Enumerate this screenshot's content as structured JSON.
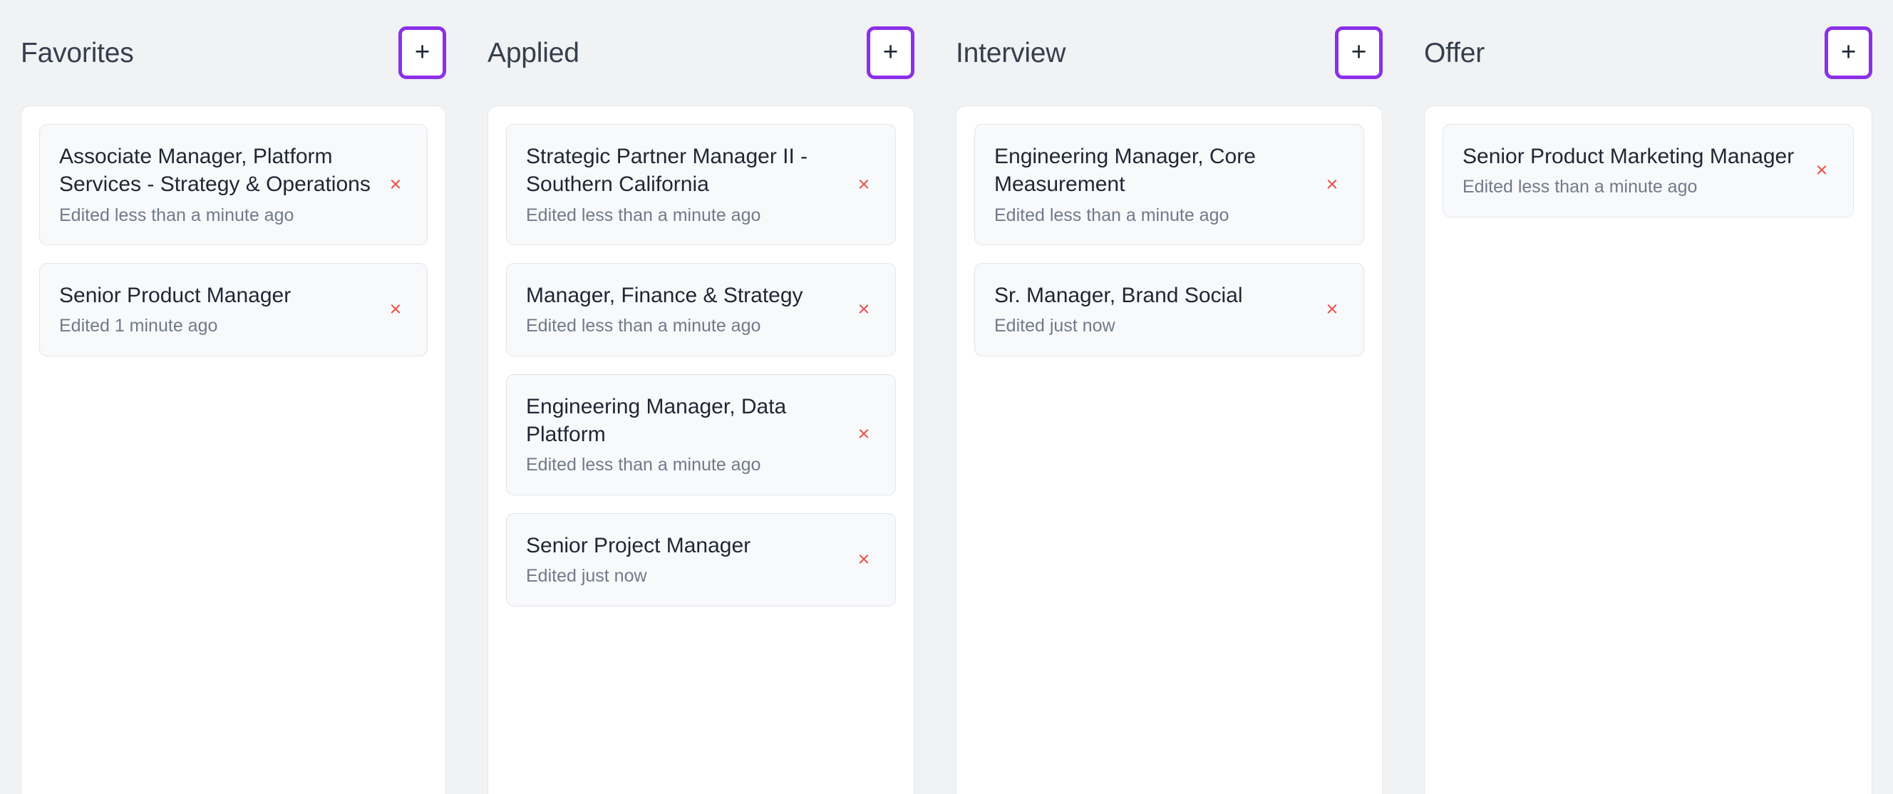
{
  "board": {
    "add_button_label": "+",
    "remove_button_label": "×",
    "accent_color": "#8b30e8",
    "remove_color": "#e8534a",
    "title_color": "#363f4d",
    "meta_color": "#707a89",
    "page_background": "#f1f2f4",
    "column_background": "#ffffff",
    "card_background": "#f8f9fb"
  },
  "columns": [
    {
      "title": "Favorites",
      "cards": [
        {
          "title": "Associate Manager, Platform Services - Strategy & Operations",
          "meta": "Edited less than a minute ago"
        },
        {
          "title": "Senior Product Manager",
          "meta": "Edited 1 minute ago"
        }
      ]
    },
    {
      "title": "Applied",
      "cards": [
        {
          "title": "Strategic Partner Manager II - Southern California",
          "meta": "Edited less than a minute ago"
        },
        {
          "title": "Manager, Finance & Strategy",
          "meta": "Edited less than a minute ago"
        },
        {
          "title": "Engineering Manager, Data Platform",
          "meta": "Edited less than a minute ago"
        },
        {
          "title": "Senior Project Manager",
          "meta": "Edited just now"
        }
      ]
    },
    {
      "title": "Interview",
      "cards": [
        {
          "title": "Engineering Manager, Core Measurement",
          "meta": "Edited less than a minute ago"
        },
        {
          "title": "Sr. Manager, Brand Social",
          "meta": "Edited just now"
        }
      ]
    },
    {
      "title": "Offer",
      "cards": [
        {
          "title": "Senior Product Marketing Manager",
          "meta": "Edited less than a minute ago"
        }
      ]
    }
  ]
}
